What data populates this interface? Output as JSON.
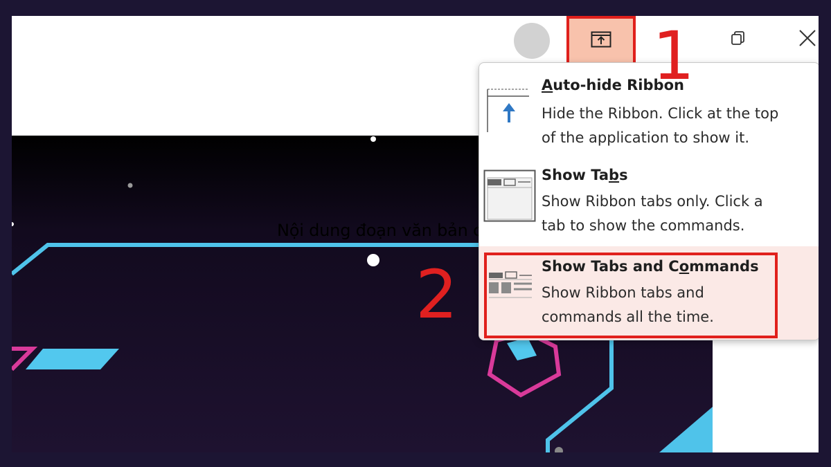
{
  "window": {
    "ribbon_display_options_icon": "ribbon-display-options-icon",
    "restore_icon": "restore-icon",
    "close_icon": "close-icon",
    "avatar": "avatar"
  },
  "slide": {
    "text": "Nội dung đoạn văn bản của bạn"
  },
  "menu": {
    "items": [
      {
        "title_parts": [
          "",
          "A",
          "uto-hide Ribbon"
        ],
        "desc_lines": [
          "Hide the Ribbon. Click at the top",
          "of the application to show it."
        ],
        "icon": "auto-hide-ribbon-icon"
      },
      {
        "title_parts": [
          "Show Ta",
          "b",
          "s"
        ],
        "desc_lines": [
          "Show Ribbon tabs only. Click a",
          "tab to show the commands."
        ],
        "icon": "show-tabs-icon"
      },
      {
        "title_parts": [
          "Show Tabs and C",
          "o",
          "mmands"
        ],
        "desc_lines": [
          "Show Ribbon tabs and",
          "commands all the time."
        ],
        "icon": "show-tabs-and-commands-icon",
        "selected": true
      }
    ]
  },
  "annotations": {
    "step1": "1",
    "step2": "2"
  },
  "colors": {
    "highlight": "#e0201c",
    "button_active": "#f8c2ac",
    "selected_item": "#fbe9e6",
    "accent_blue": "#2f78c4"
  }
}
